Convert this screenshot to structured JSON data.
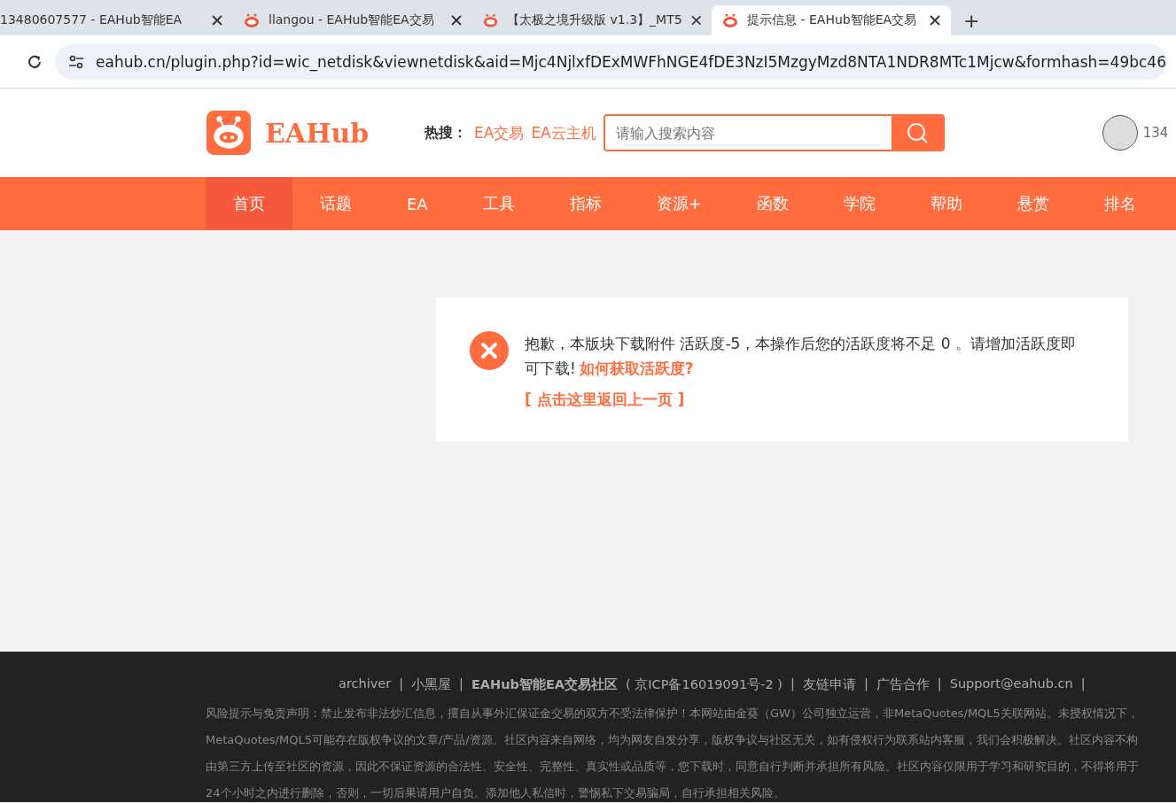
{
  "browser": {
    "tabs": [
      {
        "title": "13480607577 - EAHub智能EA",
        "selected": false
      },
      {
        "title": "llangou - EAHub智能EA交易",
        "selected": false
      },
      {
        "title": "【太极之境升级版 v1.3】_MT5",
        "selected": false
      },
      {
        "title": "提示信息 - EAHub智能EA交易",
        "selected": true
      }
    ],
    "new_tab": "+",
    "url": "eahub.cn/plugin.php?id=wic_netdisk&viewnetdisk&aid=Mjc4NjlxfDExMWFhNGE4fDE3NzI5MzgyMzd8NTA1NDR8MTc1Mjcw&formhash=49bc46"
  },
  "header": {
    "logo": "EAHub",
    "hot_label": "热搜：",
    "hot_links": [
      "EA交易",
      "EA云主机"
    ],
    "search": {
      "placeholder": "请输入搜索内容"
    },
    "user": "134"
  },
  "nav": [
    {
      "label": "首页",
      "selected": true
    },
    {
      "label": "话题",
      "selected": false
    },
    {
      "label": "EA",
      "selected": false
    },
    {
      "label": "工具",
      "selected": false
    },
    {
      "label": "指标",
      "selected": false
    },
    {
      "label": "资源+",
      "selected": false
    },
    {
      "label": "函数",
      "selected": false
    },
    {
      "label": "学院",
      "selected": false
    },
    {
      "label": "帮助",
      "selected": false
    },
    {
      "label": "悬赏",
      "selected": false
    },
    {
      "label": "排名",
      "selected": false
    }
  ],
  "message": {
    "text": "抱歉，本版块下载附件 活跃度-5，本操作后您的活跃度将不足 0 。请增加活跃度即可下载!",
    "help_link": "如何获取活跃度?",
    "back_link": "[ 点击这里返回上一页 ]"
  },
  "footer": {
    "links": [
      {
        "text": "archiver",
        "kind": "link"
      },
      {
        "text": "|",
        "kind": "sep"
      },
      {
        "text": "小黑屋",
        "kind": "link"
      },
      {
        "text": "|",
        "kind": "sep"
      },
      {
        "text": "EAHub智能EA交易社区",
        "kind": "bold"
      },
      {
        "text": "( 京ICP备16019091号-2 )",
        "kind": "link"
      },
      {
        "text": "|",
        "kind": "sep"
      },
      {
        "text": "友链申请",
        "kind": "link"
      },
      {
        "text": "|",
        "kind": "sep"
      },
      {
        "text": "广告合作",
        "kind": "link"
      },
      {
        "text": "|",
        "kind": "sep"
      },
      {
        "text": "Support@eahub.cn",
        "kind": "link"
      },
      {
        "text": "|",
        "kind": "sep"
      }
    ],
    "disclaimer": [
      "风险提示与免责声明：禁止发布非法炒汇信息，擅自从事外汇保证金交易的双方不受法律保护！本网站由金葵（GW）公司独立运营，非MetaQuotes/MQL5关联网站。未授权情况下，",
      "MetaQuotes/MQL5可能存在版权争议的文章/产品/资源。社区内容来自网络，均为网友自发分享，版权争议与社区无关，如有侵权行为联系站内客服，我们会积极解决。社区内容不构",
      "由第三方上传至社区的资源，因此不保证资源的合法性、安全性、完整性、真实性或品质等，您下载时，同意自行判断并承担所有风险。社区内容仅限用于学习和研究目的，不得将用于",
      "24个小时之内进行删除，否则，一切后果请用户自负。添加他人私信时，警惕私下交易骗局，自行承担相关风险。"
    ]
  }
}
